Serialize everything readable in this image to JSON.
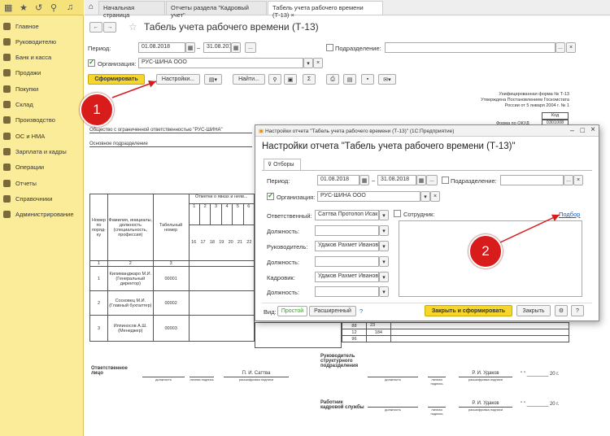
{
  "sidebar": {
    "items": [
      {
        "label": "Главное",
        "icon": "menu-icon"
      },
      {
        "label": "Руководителю",
        "icon": "chart-icon"
      },
      {
        "label": "Банк и касса",
        "icon": "bank-icon"
      },
      {
        "label": "Продажи",
        "icon": "cart-icon"
      },
      {
        "label": "Покупки",
        "icon": "basket-icon"
      },
      {
        "label": "Склад",
        "icon": "box-icon"
      },
      {
        "label": "Производство",
        "icon": "factory-icon"
      },
      {
        "label": "ОС и НМА",
        "icon": "assets-icon"
      },
      {
        "label": "Зарплата и кадры",
        "icon": "people-icon"
      },
      {
        "label": "Операции",
        "icon": "operations-icon"
      },
      {
        "label": "Отчеты",
        "icon": "reports-icon"
      },
      {
        "label": "Справочники",
        "icon": "book-icon"
      },
      {
        "label": "Администрирование",
        "icon": "gear-icon"
      }
    ]
  },
  "tabs": [
    "Начальная страница",
    "Отчеты раздела \"Кадровый учет\"",
    "Табель учета рабочего времени (Т-13)"
  ],
  "report": {
    "title": "Табель учета рабочего времени (Т-13)",
    "period_label": "Период:",
    "date_from": "01.08.2018",
    "date_to": "31.08.2018",
    "dash": "–",
    "subdivision_label": "Подразделение:",
    "org_label": "Организация:",
    "org_value": "РУС-ШИНА ООО",
    "btn_generate": "Сформировать",
    "btn_settings": "Настройки...",
    "btn_find": "Найти...",
    "sigma": "Σ",
    "dots": "...",
    "x": "×"
  },
  "document": {
    "form_header": [
      "Унифицированная форма № Т-13",
      "Утверждена Постановлением Госкомстата",
      "России от 5 января 2004 г. № 1"
    ],
    "code_label": "Код",
    "okud_label": "Форма по ОКУД",
    "okud_value": "0301008",
    "company": "Общество с ограниченной ответственностью \"РУС-ШИНА\"",
    "dept": "Основное подразделение",
    "col_headers": [
      "Номер по поряд-ку",
      "Фамилия, инициалы, должность (специальность, профессия)",
      "Табельный номер",
      "Отметки о явках и неяв..."
    ],
    "days_top": [
      "1",
      "2",
      "3",
      "4",
      "5",
      "6"
    ],
    "days_bottom": [
      "16",
      "17",
      "18",
      "19",
      "20",
      "21",
      "22"
    ],
    "col_nums": [
      "1",
      "2",
      "3"
    ],
    "rows": [
      {
        "num": "1",
        "name": "Килиманджаро М.И. (Генеральный директор)",
        "tab": "00001"
      },
      {
        "num": "2",
        "name": "Сосковец М.И. (Главный бухгалтер)",
        "tab": "00002"
      },
      {
        "num": "3",
        "name": "Иппиносов А.Ш. (Менеджер)",
        "tab": "00003"
      }
    ],
    "row3_vals": [
      "23",
      "184",
      "88",
      "12",
      "96"
    ],
    "sig1_label": "Ответственное лицо",
    "sig1_role": "должность",
    "sig1_sign": "личная подпись",
    "sig1_name": "П. И. Саттва",
    "sig1_decode": "расшифровка подписи",
    "sig2_label": "Руководитель структурного подразделения",
    "sig2_role": "должность",
    "sig2_sign": "личная подпись",
    "sig2_name": "Р. И. Удаков",
    "sig2_decode": "расшифровка подписи",
    "date_line": "\" \"  ________ 20   г.",
    "sig3_label": "Работник кадровой службы",
    "sig3_role": "должность",
    "sig3_sign": "личная подпись",
    "sig3_name": "Р. И. Удаков",
    "sig3_decode": "расшифровка подписи"
  },
  "dialog": {
    "title": "Настройки отчета \"Табель учета рабочего времени (Т-13)\" (1С:Предприятие)",
    "heading": "Настройки отчета \"Табель учета рабочего времени (Т-13)\"",
    "tab_filters": "Отборы",
    "period_label": "Период:",
    "date_from": "01.08.2018",
    "date_to": "31.08.2018",
    "subdivision_label": "Подразделение:",
    "org_label": "Организация:",
    "org_value": "РУС-ШИНА ООО",
    "responsible_label": "Ответственный:",
    "responsible_value": "Саттва Протопоп Исак",
    "position1_label": "Должность:",
    "head_label": "Руководитель:",
    "head_value": "Удаков Рахмет Иванов",
    "position2_label": "Должность:",
    "hr_label": "Кадровик:",
    "hr_value": "Удаков Рахмет Иванов",
    "position3_label": "Должность:",
    "employee_label": "Сотрудник:",
    "select_link": "Подбор",
    "view_label": "Вид:",
    "view_simple": "Простой",
    "view_extended": "Расширенный",
    "help": "?",
    "btn_close_generate": "Закрыть и сформировать",
    "btn_close": "Закрыть"
  },
  "annotations": {
    "one": "1",
    "two": "2"
  },
  "colors": {
    "sidebar": "#fbec9a",
    "accent": "#f7d62c",
    "marker": "#d81b1b",
    "link": "#1c5fb4"
  }
}
